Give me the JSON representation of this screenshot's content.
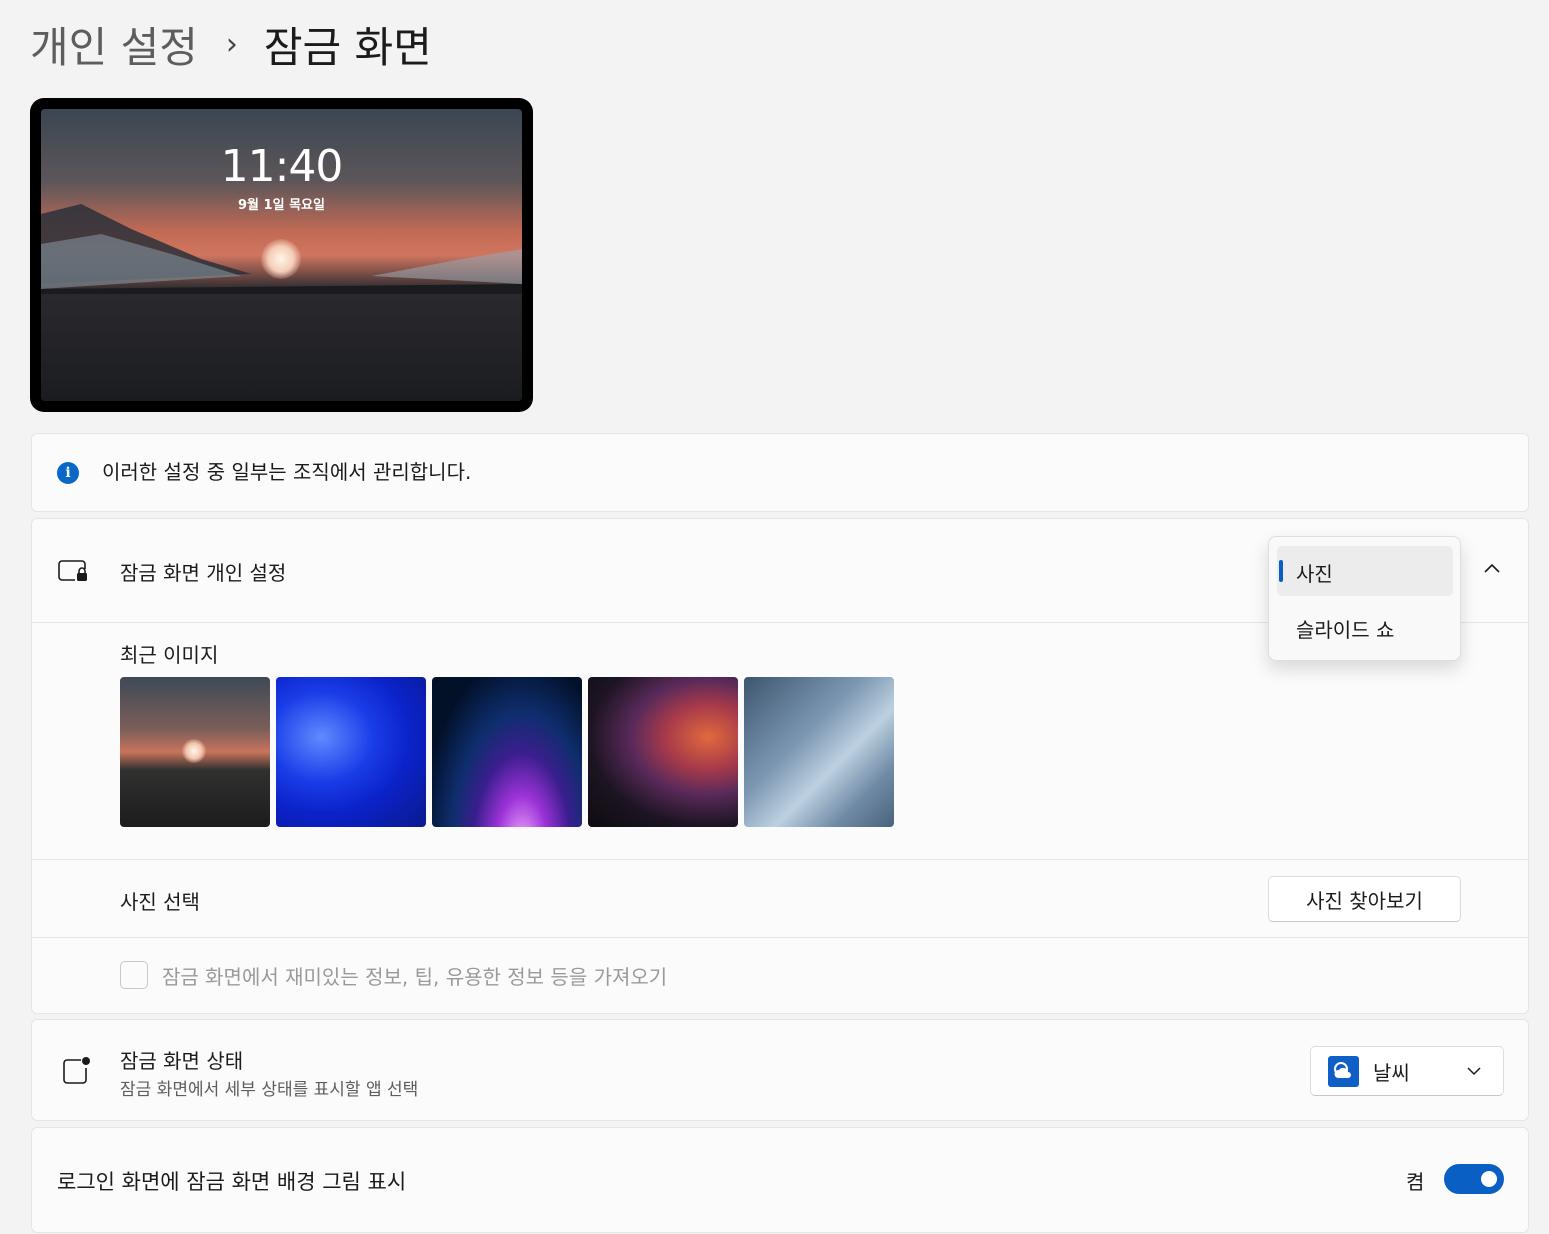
{
  "breadcrumb": {
    "parent": "개인 설정",
    "separator": "›",
    "current": "잠금 화면"
  },
  "preview": {
    "time": "11:40",
    "date": "9월 1일 목요일"
  },
  "info": {
    "text": "이러한 설정 중 일부는 조직에서 관리합니다."
  },
  "personalize": {
    "title": "잠금 화면 개인 설정",
    "dropdown": {
      "options": [
        "사진",
        "슬라이드 쇼"
      ],
      "selected": "사진"
    },
    "recent_label": "최근 이미지",
    "choose_label": "사진 선택",
    "browse_label": "사진 찾아보기",
    "fun_facts_label": "잠금 화면에서 재미있는 정보, 팁, 유용한 정보 등을 가져오기",
    "fun_facts_checked": false
  },
  "status": {
    "title": "잠금 화면 상태",
    "subtitle": "잠금 화면에서 세부 상태를 표시할 앱 선택",
    "selected_app": "날씨",
    "app_icon": "weather-icon"
  },
  "login": {
    "label": "로그인 화면에 잠금 화면 배경 그림 표시",
    "toggle_label": "켬",
    "toggle_on": true
  },
  "colors": {
    "accent": "#0a5fc4",
    "info": "#0a67c7"
  }
}
